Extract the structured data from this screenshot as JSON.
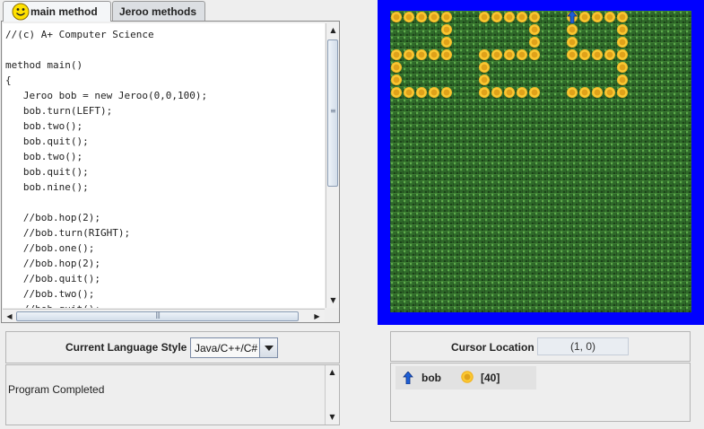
{
  "tabs": [
    {
      "label": "main method",
      "active": true
    },
    {
      "label": "Jeroo methods",
      "active": false
    }
  ],
  "editor": {
    "lines": [
      "//(c) A+ Computer Science",
      "",
      "method main()",
      "{",
      "   Jeroo bob = new Jeroo(0,0,100);",
      "   bob.turn(LEFT);",
      "   bob.two();",
      "   bob.quit();",
      "   bob.two();",
      "   bob.quit();",
      "   bob.nine();",
      "",
      "   //bob.hop(2);",
      "   //bob.turn(RIGHT);",
      "   //bob.one();",
      "   //bob.hop(2);",
      "   //bob.quit();",
      "   //bob.two();",
      "   //bob.quit();"
    ]
  },
  "language": {
    "label": "Current Language Style",
    "value": "Java/C++/C#"
  },
  "console": {
    "text": "Program Completed"
  },
  "cursor": {
    "label": "Cursor Location",
    "value": "(1, 0)"
  },
  "status": {
    "jeroo_name": "bob",
    "flowers": "[40]"
  },
  "colors": {
    "water": "#0000ff",
    "grass": "#2f6a2a",
    "flower": "#ffd23a",
    "jeroo": "#1e5fd6"
  },
  "world": {
    "grid_size": 24,
    "jeroo": {
      "name": "bob",
      "row": 0,
      "col": 14,
      "facing": "north"
    },
    "flower_cells": [
      [
        0,
        0
      ],
      [
        0,
        1
      ],
      [
        0,
        2
      ],
      [
        0,
        3
      ],
      [
        0,
        4
      ],
      [
        0,
        7
      ],
      [
        0,
        8
      ],
      [
        0,
        9
      ],
      [
        0,
        10
      ],
      [
        0,
        11
      ],
      [
        0,
        14
      ],
      [
        0,
        15
      ],
      [
        0,
        16
      ],
      [
        0,
        17
      ],
      [
        0,
        18
      ],
      [
        1,
        4
      ],
      [
        1,
        11
      ],
      [
        1,
        14
      ],
      [
        1,
        18
      ],
      [
        2,
        4
      ],
      [
        2,
        11
      ],
      [
        2,
        14
      ],
      [
        2,
        18
      ],
      [
        3,
        0
      ],
      [
        3,
        1
      ],
      [
        3,
        2
      ],
      [
        3,
        3
      ],
      [
        3,
        4
      ],
      [
        3,
        7
      ],
      [
        3,
        8
      ],
      [
        3,
        9
      ],
      [
        3,
        10
      ],
      [
        3,
        11
      ],
      [
        3,
        14
      ],
      [
        3,
        15
      ],
      [
        3,
        16
      ],
      [
        3,
        17
      ],
      [
        3,
        18
      ],
      [
        4,
        0
      ],
      [
        4,
        7
      ],
      [
        4,
        18
      ],
      [
        5,
        0
      ],
      [
        5,
        7
      ],
      [
        5,
        18
      ],
      [
        6,
        0
      ],
      [
        6,
        1
      ],
      [
        6,
        2
      ],
      [
        6,
        3
      ],
      [
        6,
        4
      ],
      [
        6,
        7
      ],
      [
        6,
        8
      ],
      [
        6,
        9
      ],
      [
        6,
        10
      ],
      [
        6,
        11
      ],
      [
        6,
        14
      ],
      [
        6,
        15
      ],
      [
        6,
        16
      ],
      [
        6,
        17
      ],
      [
        6,
        18
      ]
    ]
  }
}
